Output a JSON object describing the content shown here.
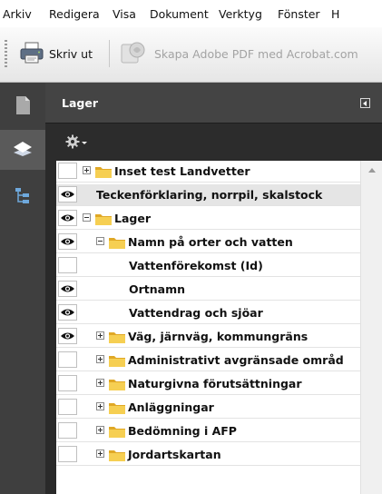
{
  "menu": [
    "Arkiv",
    "Redigera",
    "Visa",
    "Dokument",
    "Verktyg",
    "Fönster",
    "H"
  ],
  "toolbar": {
    "print_label": "Skriv ut",
    "pdf_label": "Skapa Adobe PDF med Acrobat.com"
  },
  "panel": {
    "title": "Lager"
  },
  "layers": [
    {
      "label": "Inset test Landvetter",
      "visible": false,
      "expander": "plus",
      "folder": true
    },
    {
      "label": "Teckenförklaring, norrpil, skalstock",
      "visible": true,
      "expander": "none",
      "folder": false,
      "selected": true
    },
    {
      "label": "Lager",
      "visible": true,
      "expander": "minus",
      "folder": true
    },
    {
      "label": "Namn på orter och vatten",
      "visible": true,
      "expander": "minus",
      "folder": true
    },
    {
      "label": "Vattenförekomst (Id)",
      "visible": false,
      "expander": "none",
      "folder": false
    },
    {
      "label": "Ortnamn",
      "visible": true,
      "expander": "none",
      "folder": false
    },
    {
      "label": "Vattendrag och sjöar",
      "visible": true,
      "expander": "none",
      "folder": false
    },
    {
      "label": "Väg, järnväg, kommungräns",
      "visible": true,
      "expander": "plus",
      "folder": true
    },
    {
      "label": "Administrativt avgränsade områd",
      "visible": false,
      "expander": "plus",
      "folder": true
    },
    {
      "label": "Naturgivna förutsättningar",
      "visible": false,
      "expander": "plus",
      "folder": true
    },
    {
      "label": "Anläggningar",
      "visible": false,
      "expander": "plus",
      "folder": true
    },
    {
      "label": "Bedömning i AFP",
      "visible": false,
      "expander": "plus",
      "folder": true
    },
    {
      "label": "Jordartskartan",
      "visible": false,
      "expander": "plus",
      "folder": true
    }
  ],
  "colors": {
    "panel_bg": "#2a2a2a",
    "folder": "#f2c94c",
    "selected_row": "#e5e5e5"
  }
}
